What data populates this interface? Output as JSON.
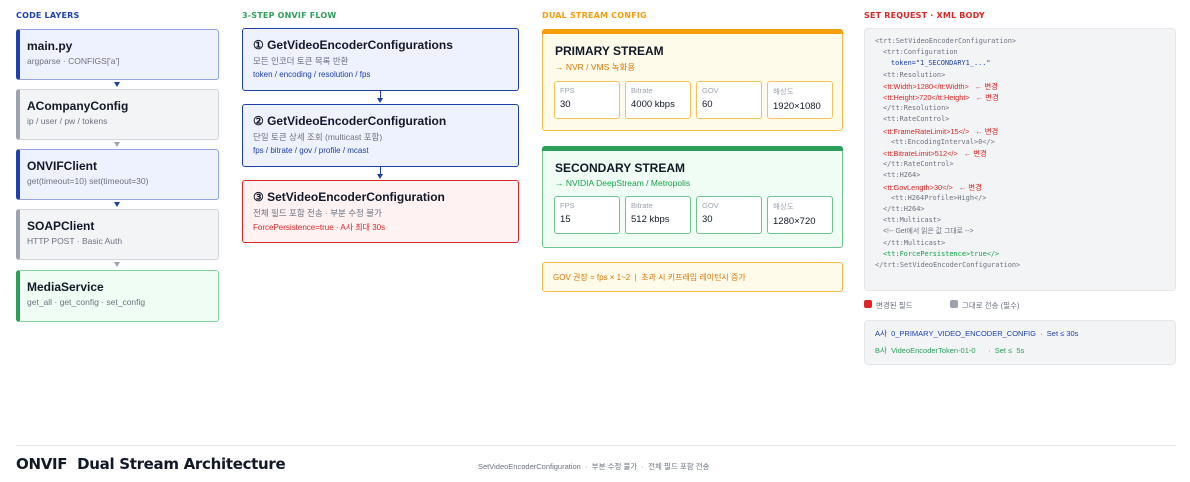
{
  "columns": {
    "layers_title": "CODE LAYERS",
    "flow_title": "3-STEP ONVIF FLOW",
    "dual_title": "DUAL STREAM CONFIG",
    "request_title": "SET REQUEST · XML BODY"
  },
  "colors": {
    "blue": "#1e40af",
    "orange": "#f59e0b",
    "green": "#2e9e5b",
    "red": "#dc2626",
    "gray": "#9ca3af"
  },
  "layers": [
    {
      "title": "main.py",
      "sub": "argparse · CONFIGS['a']",
      "style": "blue"
    },
    {
      "title": "ACompanyConfig",
      "sub": "ip / user / pw / tokens",
      "style": "gray"
    },
    {
      "title": "ONVIFClient",
      "sub": "get(timeout=10)  set(timeout=30)",
      "style": "blue"
    },
    {
      "title": "SOAPClient",
      "sub": "HTTP POST · Basic Auth",
      "style": "gray"
    },
    {
      "title": "MediaService",
      "sub": "get_all · get_config · set_config",
      "style": "green"
    }
  ],
  "steps": [
    {
      "title": "① GetVideoEncoderConfigurations",
      "desc": "모든 인코더 토큰 목록 반환",
      "detail": "token / encoding / resolution / fps"
    },
    {
      "title": "② GetVideoEncoderConfiguration",
      "desc": "단일 토큰 상세 조회 (multicast 포함)",
      "detail": "fps / bitrate / gov / profile / mcast"
    },
    {
      "title": "③ SetVideoEncoderConfiguration",
      "desc": "전체 필드 포함 전송 · 부분 수정 불가",
      "detail": "ForcePersistence=true · A사 최대 30s"
    }
  ],
  "streams": [
    {
      "title": "PRIMARY STREAM",
      "target": "→ NVR / VMS 녹화용",
      "metrics": [
        {
          "label": "FPS",
          "value": "30"
        },
        {
          "label": "Bitrate",
          "value": "4000 kbps"
        },
        {
          "label": "GOV",
          "value": "60"
        },
        {
          "label": "해상도",
          "value": "1920×1080"
        }
      ]
    },
    {
      "title": "SECONDARY STREAM",
      "target": "→ NVIDIA DeepStream / Metropolis",
      "metrics": [
        {
          "label": "FPS",
          "value": "15"
        },
        {
          "label": "Bitrate",
          "value": "512 kbps"
        },
        {
          "label": "GOV",
          "value": "30"
        },
        {
          "label": "해상도",
          "value": "1280×720"
        }
      ]
    }
  ],
  "gov_note": "GOV 권장 = fps × 1~2  |  초과 시 키프레임 레이턴시 증가",
  "xml": {
    "lines": [
      {
        "text": "<trt:SetVideoEncoderConfiguration>",
        "kind": "plain",
        "indent": 0
      },
      {
        "text": "<trt:Configuration",
        "kind": "plain",
        "indent": 1
      },
      {
        "text": "token=\"1_SECONDARY1_...\"",
        "kind": "token",
        "indent": 2
      },
      {
        "text": "<tt:Resolution>",
        "kind": "plain",
        "indent": 1
      },
      {
        "text": "<tt:Width>1280</tt:Width>",
        "kind": "changed",
        "indent": 1,
        "note": "← 변경"
      },
      {
        "text": "<tt:Height>720</tt:Height>",
        "kind": "changed",
        "indent": 1,
        "note": "← 변경"
      },
      {
        "text": "</tt:Resolution>",
        "kind": "plain",
        "indent": 1
      },
      {
        "text": "<tt:RateControl>",
        "kind": "plain",
        "indent": 1
      },
      {
        "text": "<tt:FrameRateLimit>15</>",
        "kind": "changed",
        "indent": 1,
        "note": "← 변경"
      },
      {
        "text": "<tt:EncodingInterval>0</>",
        "kind": "plain",
        "indent": 2
      },
      {
        "text": "<tt:BitrateLimit>512</>",
        "kind": "changed",
        "indent": 1,
        "note": "← 변경"
      },
      {
        "text": "</tt:RateControl>",
        "kind": "plain",
        "indent": 1
      },
      {
        "text": "<tt:H264>",
        "kind": "plain",
        "indent": 1
      },
      {
        "text": "<tt:GovLength>30</>",
        "kind": "changed",
        "indent": 1,
        "note": "← 변경"
      },
      {
        "text": "<tt:H264Profile>High</>",
        "kind": "plain",
        "indent": 2
      },
      {
        "text": "</tt:H264>",
        "kind": "plain",
        "indent": 1
      },
      {
        "text": "<tt:Multicast>",
        "kind": "plain",
        "indent": 1
      },
      {
        "text": "<!-- Get에서 읽은 값 그대로 -->",
        "kind": "comment",
        "indent": 1
      },
      {
        "text": "</tt:Multicast>",
        "kind": "plain",
        "indent": 1
      },
      {
        "text": "<tt:ForcePersistence>true</>",
        "kind": "keep",
        "indent": 1
      },
      {
        "text": "</trt:SetVideoEncoderConfiguration>",
        "kind": "plain",
        "indent": 0
      }
    ]
  },
  "legend": {
    "changed": "변경된 필드",
    "unchanged": "그대로 전송 (필수)"
  },
  "tokens": [
    {
      "text": "A사  0_PRIMARY_VIDEO_ENCODER_CONFIG  ·  Set ≤ 30s",
      "color": "#1e40af"
    },
    {
      "text": "B사  VideoEncoderToken-01-0      ·  Set ≤  5s",
      "color": "#2e9e5b"
    }
  ],
  "footer": {
    "title": "ONVIF  Dual Stream Architecture",
    "note": "SetVideoEncoderConfiguration  ·  부분 수정 불가  ·  전체 필드 포함 전송"
  }
}
